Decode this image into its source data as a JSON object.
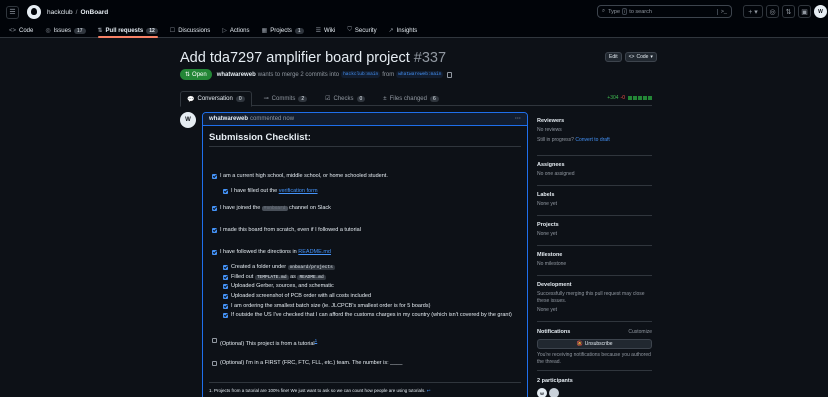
{
  "header": {
    "owner": "hackclub",
    "repo": "OnBoard",
    "search_placeholder": "Type",
    "search_suffix": "to search",
    "search_key": "/",
    "avatar": "W"
  },
  "repo_nav": [
    {
      "label": "Code",
      "icon": "<>",
      "count": ""
    },
    {
      "label": "Issues",
      "icon": "◎",
      "count": "17"
    },
    {
      "label": "Pull requests",
      "icon": "⇅",
      "count": "12"
    },
    {
      "label": "Discussions",
      "icon": "☐",
      "count": ""
    },
    {
      "label": "Actions",
      "icon": "▷",
      "count": ""
    },
    {
      "label": "Projects",
      "icon": "▦",
      "count": "1"
    },
    {
      "label": "Wiki",
      "icon": "☰",
      "count": ""
    },
    {
      "label": "Security",
      "icon": "⛉",
      "count": ""
    },
    {
      "label": "Insights",
      "icon": "↗",
      "count": ""
    }
  ],
  "pr": {
    "title": "Add tda7297 amplifier board project",
    "number": "#337",
    "state": "Open",
    "author": "whatwareweb",
    "merge_text_1": "wants to merge 2 commits into",
    "base_branch": "hackclub:main",
    "merge_text_2": "from",
    "head_branch": "whatwareweb:main",
    "edit_label": "Edit",
    "code_label": "Code"
  },
  "tabs": [
    {
      "label": "Conversation",
      "count": "0",
      "icon": "💬"
    },
    {
      "label": "Commits",
      "count": "2",
      "icon": "⊸"
    },
    {
      "label": "Checks",
      "count": "0",
      "icon": "☑"
    },
    {
      "label": "Files changed",
      "count": "6",
      "icon": "±"
    }
  ],
  "diffstat": {
    "additions": "+304",
    "deletions": "-0"
  },
  "comment": {
    "author": "whatwareweb",
    "action": "commented now",
    "heading": "Submission Checklist:",
    "items": {
      "student": "I am a current high school, middle school, or home schooled student.",
      "verif_pre": "I have filled out the",
      "verif_link": "verification form",
      "slack_pre": "I have joined the",
      "slack_code": "#onboard",
      "slack_post": "channel on Slack",
      "scratch": "I made this board from scratch, even if I followed a tutorial",
      "readme_pre": "I have followed the directions in",
      "readme_link": "README.md",
      "folder_pre": "Created a folder under",
      "folder_code": "onboard/projects",
      "filled_pre": "Filled out",
      "filled_code1": "TEMPLATE.md",
      "filled_mid": "as",
      "filled_code2": "README.md",
      "gerber": "Uploaded Gerber, sources, and schematic",
      "screenshot": "Uploaded screenshot of PCB order with all costs included",
      "batch": "I am ordering the smallest batch size (ie. JLCPCB's smallest order is for 5 boards)",
      "outside": "If outside the US I've checked that I can afford the customs charges in my country (which isn't covered by the grant)",
      "tutorial": "(Optional) This project is from a tutorial",
      "tutorial_ref": "1",
      "first": "(Optional) I'm in a FIRST (FRC, FTC, FLL, etc.) team. The number is: ____"
    },
    "footnote": "1. Projects from a tutorial are 100% fine! We just want to ask so we can count how people are using tutorials.",
    "footnote_back": "↩"
  },
  "sidebar": {
    "reviewers_h": "Reviewers",
    "reviewers_t": "No reviews",
    "draft_pre": "Still in progress?",
    "draft_link": "Convert to draft",
    "assignees_h": "Assignees",
    "assignees_t": "No one assigned",
    "labels_h": "Labels",
    "labels_t": "None yet",
    "projects_h": "Projects",
    "projects_t": "None yet",
    "milestone_h": "Milestone",
    "milestone_t": "No milestone",
    "dev_h": "Development",
    "dev_t": "Successfully merging this pull request may close these issues.",
    "dev_none": "None yet",
    "notif_h": "Notifications",
    "customize": "Customize",
    "unsubscribe": "Unsubscribe",
    "notif_t": "You're receiving notifications because you authored the thread.",
    "participants_h": "2 participants"
  }
}
